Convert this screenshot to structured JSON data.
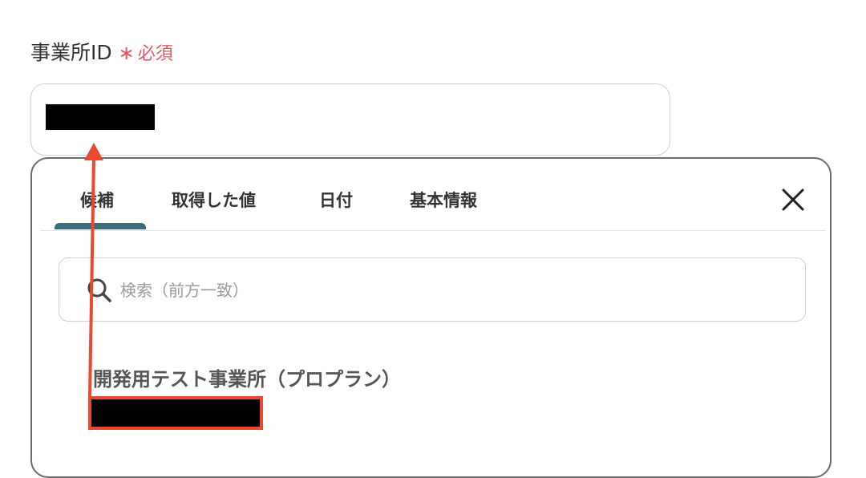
{
  "form": {
    "field_label": "事業所ID",
    "required_asterisk": "∗",
    "required_text": "必須",
    "field_value": "[redacted]"
  },
  "picker": {
    "tabs": [
      {
        "label": "候補",
        "active": true
      },
      {
        "label": "取得した値",
        "active": false
      },
      {
        "label": "日付",
        "active": false
      },
      {
        "label": "基本情報",
        "active": false
      }
    ],
    "close_icon": "close-icon",
    "search": {
      "icon": "search-icon",
      "placeholder": "検索（前方一致）",
      "value": ""
    },
    "options": [
      {
        "title": "開発用テスト事業所（プロプラン）",
        "subtitle": "[redacted]"
      }
    ]
  },
  "annotation": {
    "color": "#e8492f",
    "type": "arrow-from-option-to-field"
  },
  "colors": {
    "required": "#e05a66",
    "active_tab_underline": "#3d6a7d",
    "annotation": "#e8492f"
  }
}
